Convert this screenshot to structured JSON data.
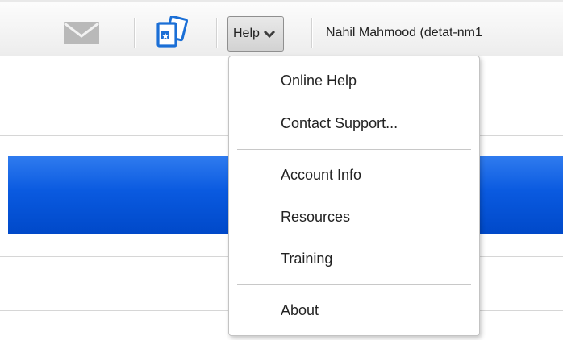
{
  "toolbar": {
    "mail_icon": "envelope-icon",
    "cards_icon": "cards-icon",
    "help_label": "Help",
    "help_chevron_icon": "chevron-down-icon",
    "user_name": "Nahil Mahmood (detat-nm1"
  },
  "help_menu": {
    "items": [
      {
        "label": "Online Help"
      },
      {
        "label": "Contact Support..."
      },
      {
        "label": "Account Info"
      },
      {
        "label": "Resources"
      },
      {
        "label": "Training"
      },
      {
        "label": "About"
      }
    ]
  },
  "colors": {
    "accent_blue": "#0a5ae0",
    "toolbar_bg": "#f4f4f4"
  }
}
